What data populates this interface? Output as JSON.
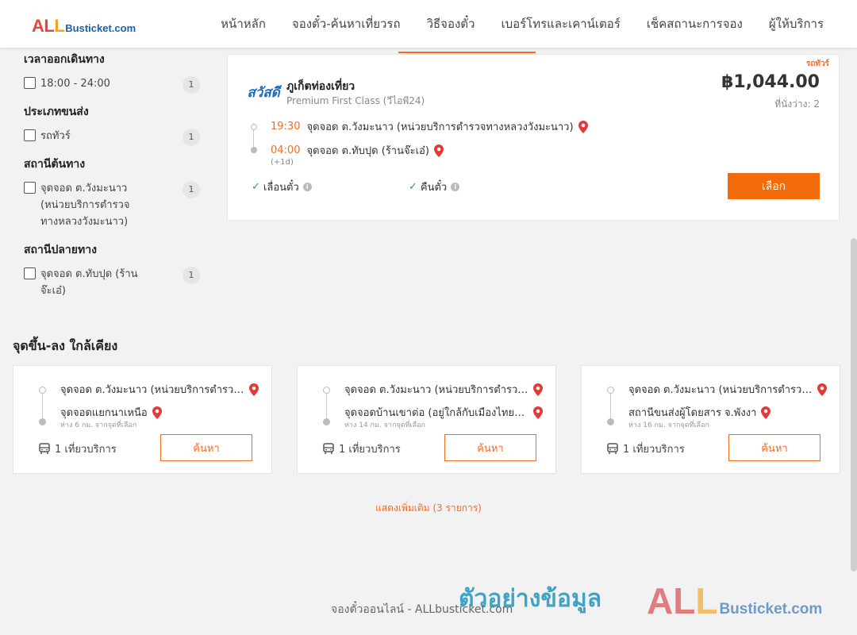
{
  "brand": {
    "logo_all": "ALL",
    "logo_rest": "Busticket.com"
  },
  "nav": {
    "items": [
      {
        "label": "หน้าหลัก"
      },
      {
        "label": "จองตั๋ว-ค้นหาเที่ยวรถ"
      },
      {
        "label": "วิธีจองตั๋ว"
      },
      {
        "label": "เบอร์โทรและเคาน์เตอร์"
      },
      {
        "label": "เช็คสถานะการจอง"
      },
      {
        "label": "ผู้ให้บริการ"
      }
    ]
  },
  "filters": [
    {
      "title": "เวลาออกเดินทาง",
      "options": [
        {
          "label": "18:00 - 24:00",
          "count": "1"
        }
      ]
    },
    {
      "title": "ประเภทขนส่ง",
      "options": [
        {
          "label": "รถทัวร์",
          "count": "1"
        }
      ]
    },
    {
      "title": "สถานีต้นทาง",
      "options": [
        {
          "label": "จุดจอด ต.วังมะนาว (หน่วยบริการตำรวจทางหลวงวังมะนาว)",
          "count": "1"
        }
      ]
    },
    {
      "title": "สถานีปลายทาง",
      "options": [
        {
          "label": "จุดจอด ต.ทับปุด (ร้านจ๊ะเอ๋)",
          "count": "1"
        }
      ]
    }
  ],
  "ticket": {
    "type_tag": "รถทัวร์",
    "operator_logo_text": "สวัสดี",
    "operator": "ภูเก็ตท่องเที่ยว",
    "class": "Premium First Class (วีไอพี24)",
    "price": "฿1,044.00",
    "seats": "ที่นั่งว่าง: 2",
    "depart_time": "19:30",
    "depart_stop": "จุดจอด ต.วังมะนาว (หน่วยบริการตำรวจทางหลวงวังมะนาว)",
    "arrive_time": "04:00",
    "arrive_stop": "จุดจอด ต.ทับปุด (ร้านจ๊ะเอ๋)",
    "next_day": "(+1d)",
    "feature_reschedule": "เลื่อนตั๋ว",
    "feature_refund": "คืนตั๋ว",
    "select_label": "เลือก"
  },
  "nearby": {
    "title": "จุดขึ้น-ลง ใกล้เคียง",
    "cards": [
      {
        "from": "จุดจอด ต.วังมะนาว (หน่วยบริการตำรวจทางหลวงวังมะนาว)",
        "to": "จุดจอดแยกนาเหนือ",
        "distance": "ห่าง 6 กม. จากจุดที่เลือก",
        "trips": "1 เที่ยวบริการ",
        "button": "ค้นหา"
      },
      {
        "from": "จุดจอด ต.วังมะนาว (หน่วยบริการตำรวจทางหลวงวังมะนาว)",
        "to": "จุดจอดบ้านเขาต่อ (อยู่ใกล้กับเมืองไทยประกันภัย)",
        "distance": "ห่าง 14 กม. จากจุดที่เลือก",
        "trips": "1 เที่ยวบริการ",
        "button": "ค้นหา"
      },
      {
        "from": "จุดจอด ต.วังมะนาว (หน่วยบริการตำรวจทางหลวงวังมะนาว)",
        "to": "สถานีขนส่งผู้โดยสาร จ.พังงา",
        "distance": "ห่าง 16 กม. จากจุดที่เลือก",
        "trips": "1 เที่ยวบริการ",
        "button": "ค้นหา"
      }
    ],
    "show_more": "แสดงเพิ่มเติม (3 รายการ)"
  },
  "footer": {
    "text": "จองตั๋วออนไลน์ - ALLbusticket.com"
  },
  "watermark": {
    "text": "ตัวอย่างข้อมูล",
    "logo_all": "ALL",
    "logo_rest": "Busticket.com"
  },
  "colors": {
    "accent": "#f36c21",
    "button": "#f36c09",
    "check": "#2ba23c",
    "pin": "#e53935",
    "logo_blue": "#1a5fa8"
  }
}
